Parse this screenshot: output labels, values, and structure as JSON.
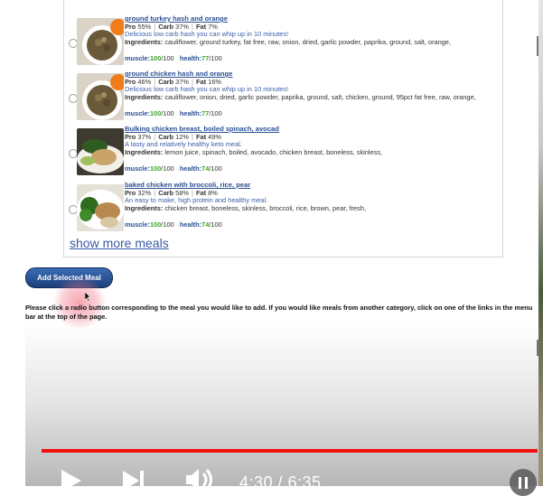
{
  "meals": [
    {
      "name": "ground turkey hash and orange",
      "pro": "55%",
      "carb": "37%",
      "fat": "7%",
      "description": "Delicious low carb hash you can whip up in 10 minutes!",
      "ingredients": "cauliflower, ground turkey, fat free, raw, onion, dried, garlic powder, paprika, ground, salt, orange,",
      "muscle": "100",
      "health": "77",
      "image": "hash-orange-photo"
    },
    {
      "name": "ground chicken hash and orange",
      "pro": "46%",
      "carb": "37%",
      "fat": "16%",
      "description": "Delicious low carb hash you can whip up in 10 minutes!",
      "ingredients": "cauliflower, onion, dried, garlic powder, paprika, ground, salt, chicken, ground, 95pct fat free, raw, orange,",
      "muscle": "100",
      "health": "77",
      "image": "hash-orange-photo"
    },
    {
      "name": "Bulking chicken breast, boiled spinach, avocad",
      "pro": "37%",
      "carb": "12%",
      "fat": "49%",
      "description": "A tasty and relatively healthy keto meal.",
      "ingredients": "lemon juice, spinach, boiled, avocado, chicken breast, boneless, skinless,",
      "muscle": "100",
      "health": "74",
      "image": "chicken-spinach-photo"
    },
    {
      "name": "baked chicken with broccoli, rice, pear",
      "pro": "32%",
      "carb": "58%",
      "fat": "8%",
      "description": "An easy to make, high protein and healthy meal.",
      "ingredients": "chicken breast, boneless, skinless, broccoli, rice, brown, pear, fresh,",
      "muscle": "100",
      "health": "74",
      "image": "chicken-broccoli-photo"
    }
  ],
  "labels": {
    "pro": "Pro",
    "carb": "Carb",
    "fat": "Fat",
    "ingredients": "Ingredients:",
    "muscle": "muscle:",
    "health": "health:",
    "out_of": "/100",
    "sep": "|"
  },
  "show_more": "show more meals",
  "add_button": "Add Selected Meal",
  "instructions": "Please click a radio button corresponding to the meal you would like to add. If you would like meals from another category, click on one of the links in the menu bar at the top of the page.",
  "video": {
    "time": "4:30 / 6:35",
    "progress_fraction": 0.99,
    "progress_color": "#f10f0f"
  }
}
